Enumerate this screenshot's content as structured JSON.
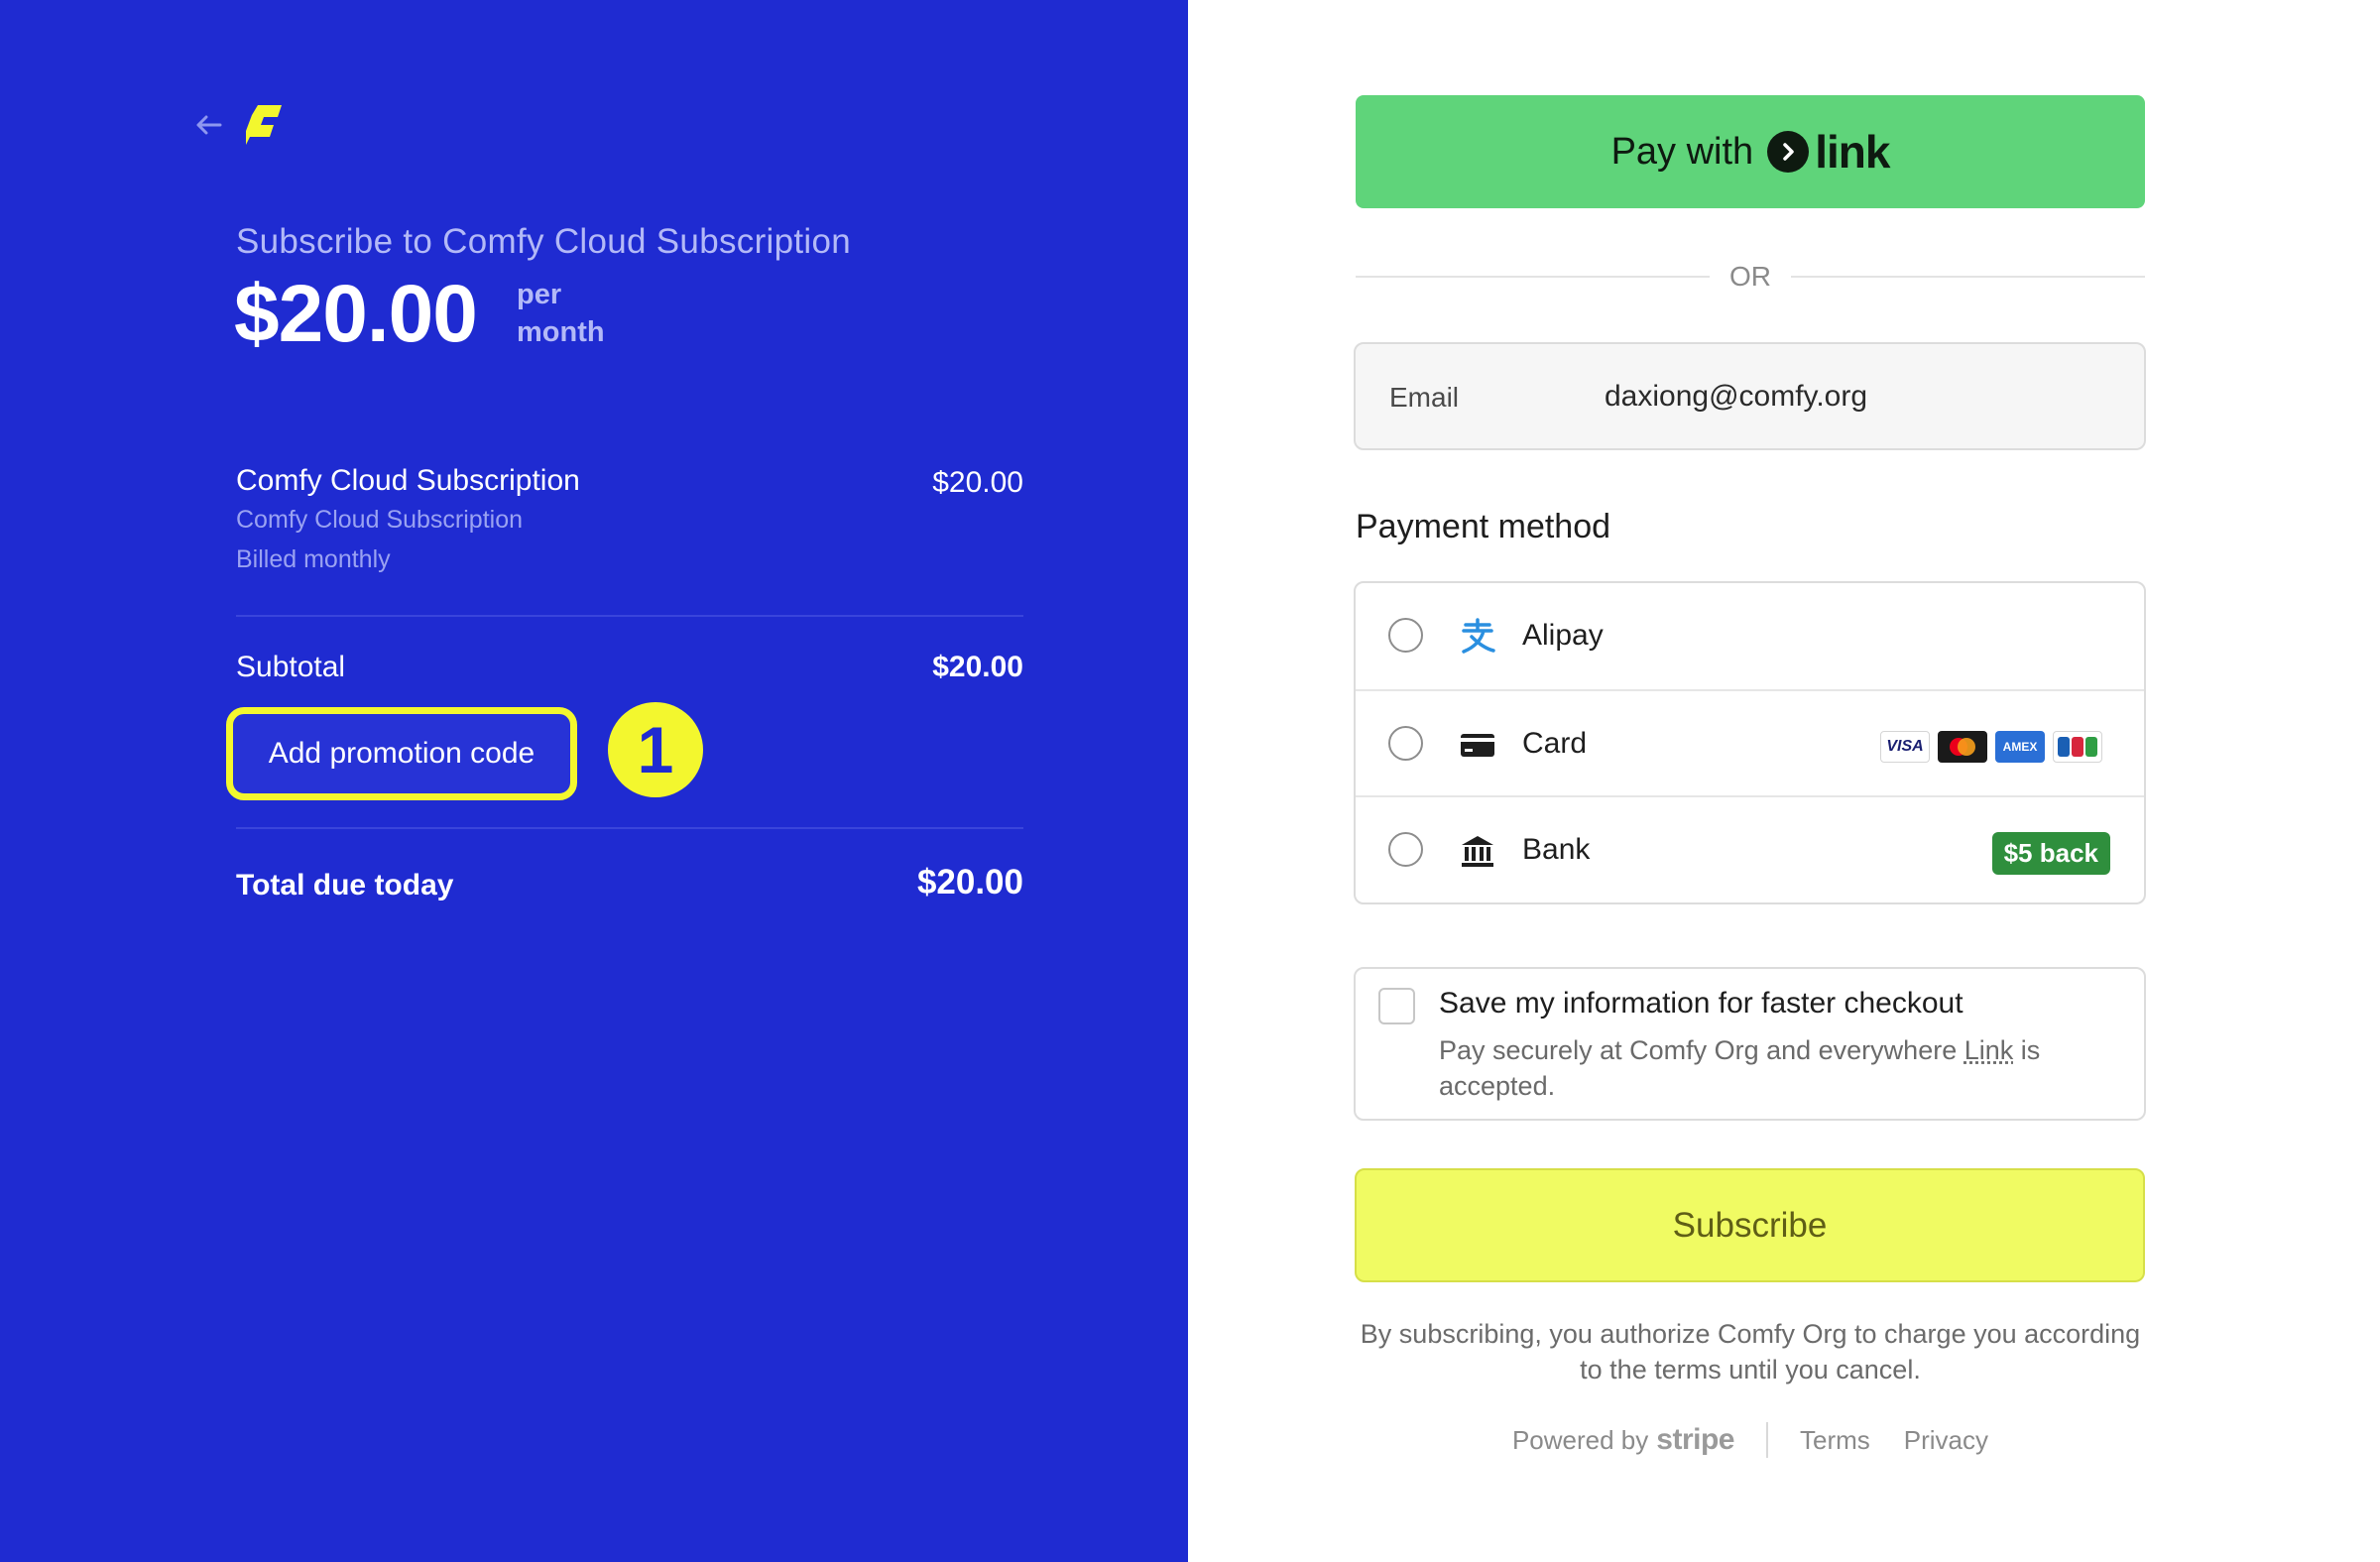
{
  "summary": {
    "title": "Subscribe to Comfy Cloud Subscription",
    "price": "$20.00",
    "period_line1": "per",
    "period_line2": "month",
    "item": {
      "name": "Comfy Cloud Subscription",
      "description": "Comfy Cloud Subscription",
      "billing": "Billed monthly",
      "price": "$20.00"
    },
    "subtotal_label": "Subtotal",
    "subtotal_value": "$20.00",
    "promo_label": "Add promotion code",
    "step_badge": "1",
    "total_label": "Total due today",
    "total_value": "$20.00"
  },
  "checkout": {
    "pay_with_label": "Pay with",
    "link_brand": "link",
    "or_label": "OR",
    "email_label": "Email",
    "email_value": "daxiong@comfy.org",
    "payment_method_heading": "Payment method",
    "methods": [
      {
        "label": "Alipay",
        "icon": "alipay-icon"
      },
      {
        "label": "Card",
        "icon": "card-icon",
        "brands": [
          "VISA",
          "Mastercard",
          "AMEX",
          "JCB"
        ]
      },
      {
        "label": "Bank",
        "icon": "bank-icon",
        "badge": "$5 back"
      }
    ],
    "save_title": "Save my information for faster checkout",
    "save_desc_before": "Pay securely at Comfy Org and everywhere ",
    "save_desc_link": "Link",
    "save_desc_after": " is accepted.",
    "subscribe_label": "Subscribe",
    "legal_text": "By subscribing, you authorize Comfy Org to charge you according to the terms until you cancel.",
    "powered_by": "Powered by",
    "stripe_brand": "stripe",
    "terms_label": "Terms",
    "privacy_label": "Privacy"
  },
  "colors": {
    "left_bg": "#1f2bd1",
    "highlight": "#f3f72e",
    "link_green": "#5fd47a",
    "subscribe_bg": "#f0fb63",
    "badge_green": "#2f8f3d"
  }
}
